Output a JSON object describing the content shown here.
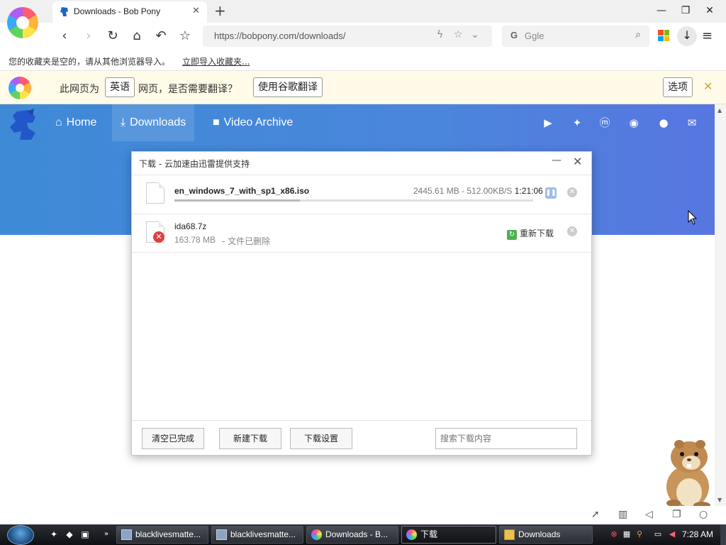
{
  "browser": {
    "tab_title": "Downloads - Bob Pony",
    "url": "https://bobpony.com/downloads/",
    "search_engine_letter": "G",
    "search_placeholder": "Ggle"
  },
  "bookmarks": {
    "message": "您的收藏夹是空的，请从其他浏览器导入。",
    "import_link": "立即导入收藏夹..."
  },
  "translate_bar": {
    "prefix": "此网页为",
    "language": "英语",
    "question": "网页，是否需要翻译？",
    "translate_button": "使用谷歌翻译",
    "options_button": "选项"
  },
  "site": {
    "nav": [
      {
        "label": "Home",
        "icon": "home-icon"
      },
      {
        "label": "Downloads",
        "icon": "download-icon"
      },
      {
        "label": "Video Archive",
        "icon": "video-icon"
      }
    ],
    "social_icons": [
      "youtube-icon",
      "twitter-icon",
      "mastodon-icon",
      "discord-icon",
      "github-icon",
      "mail-icon"
    ],
    "header_color_start": "#3e8ad6",
    "header_color_end": "#5876e0"
  },
  "download_dialog": {
    "title": "下载 - 云加速由迅雷提供支持",
    "items": [
      {
        "filename": "en_windows_7_with_sp1_x86.iso",
        "status": "2445.61 MB - 512.00KB/S",
        "eta": "1:21:06",
        "progress": 0.35
      },
      {
        "filename": "ida68.7z",
        "size": "163.78 MB",
        "status": "- 文件已删除",
        "redownload_label": "重新下载"
      }
    ],
    "footer": {
      "clear_button": "清空已完成",
      "new_button": "新建下载",
      "settings_button": "下载设置",
      "search_placeholder": "搜索下载内容"
    }
  },
  "taskbar": {
    "buttons": [
      {
        "label": "blacklivesmatte...",
        "icon": "window-icon"
      },
      {
        "label": "blacklivesmatte...",
        "icon": "window-icon"
      },
      {
        "label": "Downloads - B...",
        "icon": "browser-icon"
      },
      {
        "label": "下载",
        "icon": "browser-icon"
      },
      {
        "label": "Downloads",
        "icon": "folder-icon"
      }
    ],
    "clock": "7:28 AM"
  }
}
